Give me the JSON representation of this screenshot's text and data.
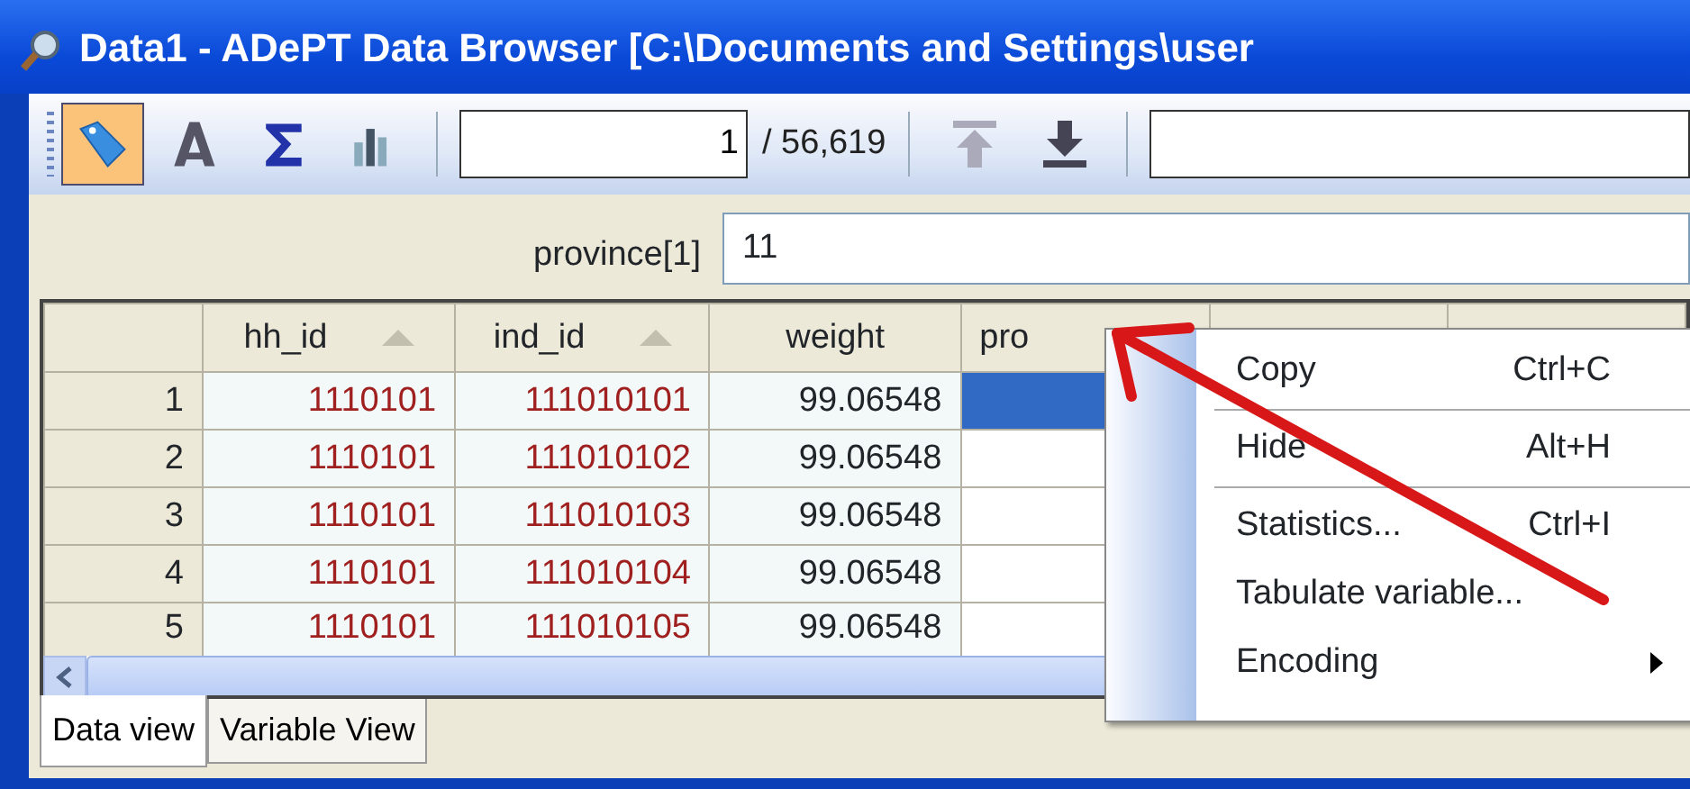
{
  "window": {
    "title": "Data1 - ADePT Data Browser [C:\\Documents and Settings\\user"
  },
  "toolbar": {
    "tools": [
      {
        "kind": "tag",
        "selected": true
      },
      {
        "kind": "font",
        "selected": false
      },
      {
        "kind": "sigma",
        "selected": false
      },
      {
        "kind": "chart",
        "selected": false
      }
    ],
    "record": {
      "value": "1",
      "total": "/ 56,619"
    },
    "nav": [
      {
        "kind": "top",
        "disabled": true
      },
      {
        "kind": "down",
        "disabled": false
      }
    ]
  },
  "formula_bar": {
    "label": "province[1]",
    "value": "11"
  },
  "table": {
    "columns": [
      {
        "label": "hh_id",
        "sorted": true
      },
      {
        "label": "ind_id",
        "sorted": true
      },
      {
        "label": "weight",
        "sorted": false
      },
      {
        "label": "pro",
        "sorted": false
      }
    ],
    "rows": [
      {
        "number": "1",
        "cells": [
          "1110101",
          "111010101",
          "99.06548"
        ],
        "selected": true
      },
      {
        "number": "2",
        "cells": [
          "1110101",
          "111010102",
          "99.06548"
        ],
        "selected": false
      },
      {
        "number": "3",
        "cells": [
          "1110101",
          "111010103",
          "99.06548"
        ],
        "selected": false
      },
      {
        "number": "4",
        "cells": [
          "1110101",
          "111010104",
          "99.06548"
        ],
        "selected": false
      },
      {
        "number": "5",
        "cells": [
          "1110101",
          "111010105",
          "99.06548"
        ],
        "selected": false
      }
    ]
  },
  "context_menu": {
    "items": [
      {
        "label": "Copy",
        "shortcut": "Ctrl+C",
        "separator_after": true
      },
      {
        "label": "Hide",
        "shortcut": "Alt+H",
        "separator_after": true
      },
      {
        "label": "Statistics...",
        "shortcut": "Ctrl+I",
        "separator_after": false
      },
      {
        "label": "Tabulate variable...",
        "separator_after": false
      },
      {
        "label": "Encoding",
        "submenu": true,
        "separator_after": false
      }
    ]
  },
  "tabs": [
    {
      "label": "Data view",
      "selected": true
    },
    {
      "label": "Variable View",
      "selected": false
    }
  ]
}
